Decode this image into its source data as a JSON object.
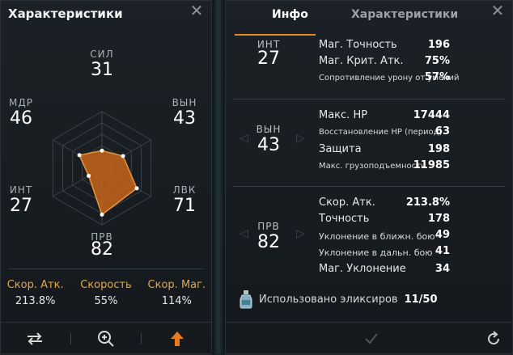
{
  "left": {
    "title": "Характеристики",
    "stats": {
      "sil": {
        "name": "СИЛ",
        "value": "31"
      },
      "vyn": {
        "name": "ВЫН",
        "value": "43"
      },
      "lvk": {
        "name": "ЛВК",
        "value": "71"
      },
      "prv": {
        "name": "ПРВ",
        "value": "82"
      },
      "int": {
        "name": "ИНТ",
        "value": "27"
      },
      "mdr": {
        "name": "МДР",
        "value": "46"
      }
    },
    "radar": {
      "axes": [
        "СИЛ",
        "ВЫН",
        "ЛВК",
        "ПРВ",
        "ИНТ",
        "МДР"
      ],
      "values": [
        31,
        43,
        71,
        82,
        27,
        46
      ],
      "max": 100,
      "fill_color": "#c8641a"
    },
    "bottom": [
      {
        "label": "Скор. Атк.",
        "value": "213.8%"
      },
      {
        "label": "Скорость",
        "value": "55%"
      },
      {
        "label": "Скор. Маг.",
        "value": "114%"
      }
    ],
    "toolbar": {
      "icons": [
        "swap-icon",
        "zoom-in-icon",
        "upgrade-arrow-icon"
      ]
    }
  },
  "right": {
    "tabs": [
      "Инфо",
      "Характеристики"
    ],
    "groups": [
      {
        "name": "ИНТ",
        "value": "27",
        "rows": [
          {
            "label": "Маг. Точность",
            "value": "196"
          },
          {
            "label": "Маг. Крит. Атк.",
            "value": "75%"
          },
          {
            "label": "Сопротивление урону от умений",
            "value": "57%"
          }
        ]
      },
      {
        "name": "ВЫН",
        "value": "43",
        "rows": [
          {
            "label": "Макс. HP",
            "value": "17444"
          },
          {
            "label": "Восстановление HP (период)",
            "value": "63"
          },
          {
            "label": "Защита",
            "value": "198"
          },
          {
            "label": "Макс. грузоподъемность",
            "value": "11985"
          }
        ]
      },
      {
        "name": "ПРВ",
        "value": "82",
        "rows": [
          {
            "label": "Скор. Атк.",
            "value": "213.8%"
          },
          {
            "label": "Точность",
            "value": "178"
          },
          {
            "label": "Уклонение в ближн. бою",
            "value": "49"
          },
          {
            "label": "Уклонение в дальн. бою",
            "value": "41"
          },
          {
            "label": "Маг. Уклонение",
            "value": "34"
          }
        ]
      }
    ],
    "elixir": {
      "label": "Использовано эликсиров",
      "count": "11/50"
    }
  },
  "colors": {
    "accent": "#e28a2a",
    "radar_fill": "#c8641a",
    "bottom_label": "#e0a84a"
  }
}
